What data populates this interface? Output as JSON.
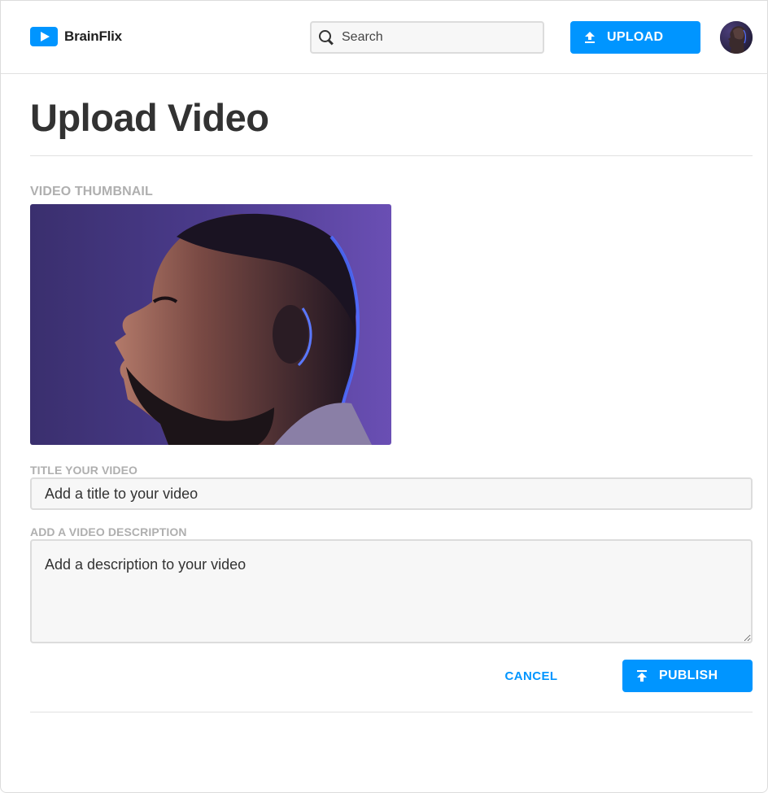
{
  "header": {
    "brand": "BrainFlix",
    "search": {
      "placeholder": "Search",
      "value": ""
    },
    "upload_label": "UPLOAD",
    "logo_icon": "play-icon",
    "search_icon": "search-icon",
    "upload_icon": "upload-icon"
  },
  "main": {
    "title": "Upload Video",
    "thumbnail_label": "VIDEO THUMBNAIL",
    "title_label": "TITLE YOUR VIDEO",
    "title_placeholder": "Add a title to your video",
    "description_label": "ADD A VIDEO DESCRIPTION",
    "description_placeholder": "Add a description to your video",
    "cancel_label": "CANCEL",
    "publish_label": "PUBLISH",
    "publish_icon": "publish-icon"
  },
  "colors": {
    "accent": "#0095ff",
    "label_gray": "#afafaf",
    "text_dark": "#323232",
    "field_bg": "#f7f7f7",
    "border": "#dcdcdc"
  }
}
